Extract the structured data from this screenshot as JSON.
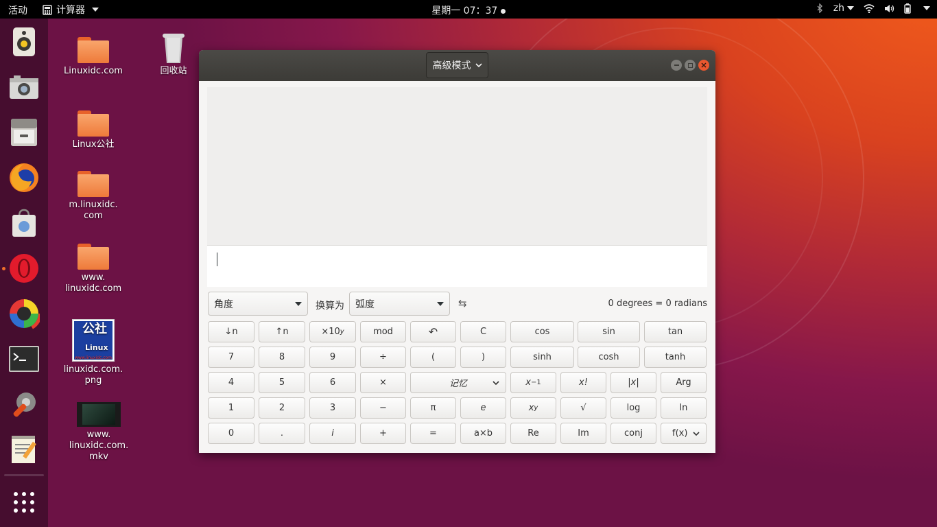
{
  "topbar": {
    "activities": "活动",
    "app_menu": "计算器",
    "clock": "星期一 07：37",
    "lang": "zh"
  },
  "desktop": {
    "icons": [
      {
        "label": "Linuxidc.com"
      },
      {
        "label": "回收站"
      },
      {
        "label": "Linux公社"
      },
      {
        "label": "m.linuxidc.\ncom"
      },
      {
        "label": "www.\nlinuxidc.com"
      },
      {
        "label": "linuxidc.com.\npng"
      },
      {
        "label": "www.\nlinuxidc.com.\nmkv"
      }
    ],
    "thumb_text": {
      "big": "公社",
      "small": "Linux",
      "url": "www.linuxidc.com"
    }
  },
  "window": {
    "mode_button": "高级模式",
    "conversion": {
      "from_unit": "角度",
      "to_label": "换算为",
      "to_unit": "弧度",
      "result": "0 degrees  =  0 radians"
    },
    "keys": {
      "row1": [
        "↓n",
        "↑n",
        "×10",
        "mod",
        "↶",
        "C",
        "cos",
        "sin",
        "tan"
      ],
      "x10_sup": "y",
      "row2": [
        "7",
        "8",
        "9",
        "÷",
        "(",
        ")",
        "sinh",
        "cosh",
        "tanh"
      ],
      "row3": [
        "4",
        "5",
        "6",
        "×",
        "记忆",
        "x",
        "x!",
        "|x|",
        "Arg"
      ],
      "xinv_sup": "−1",
      "row4": [
        "1",
        "2",
        "3",
        "−",
        "π",
        "e",
        "x",
        "√",
        "log",
        "ln"
      ],
      "xy_sup": "y",
      "row5": [
        "0",
        ".",
        "i",
        "+",
        "=",
        "a×b",
        "Re",
        "Im",
        "conj",
        "f(x)"
      ]
    }
  }
}
